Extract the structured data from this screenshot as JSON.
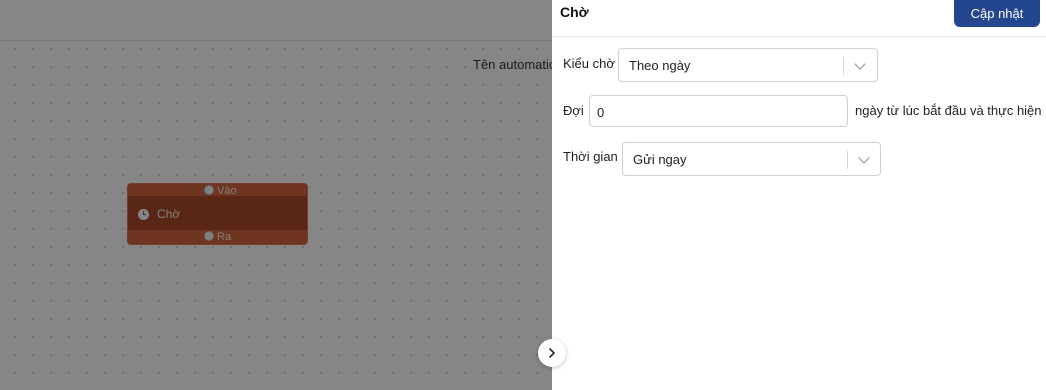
{
  "canvas": {
    "automation_name_label": "Tên automation",
    "node": {
      "title": "Chờ",
      "icon": "clock-icon",
      "input_port_label": "Vào",
      "output_port_label": "Ra"
    }
  },
  "panel": {
    "title": "Chờ",
    "update_button": "Cập nhật",
    "wait_type": {
      "label": "Kiểu chờ",
      "value": "Theo ngày"
    },
    "wait_amount": {
      "label": "Đợi",
      "value": "0",
      "suffix": "ngày từ lúc bắt đầu và thực hiện"
    },
    "time": {
      "label": "Thời gian",
      "value": "Gửi ngay"
    }
  },
  "colors": {
    "primary_button": "#23468f",
    "node_border": "#c9623b",
    "node_body": "#a5472a"
  }
}
